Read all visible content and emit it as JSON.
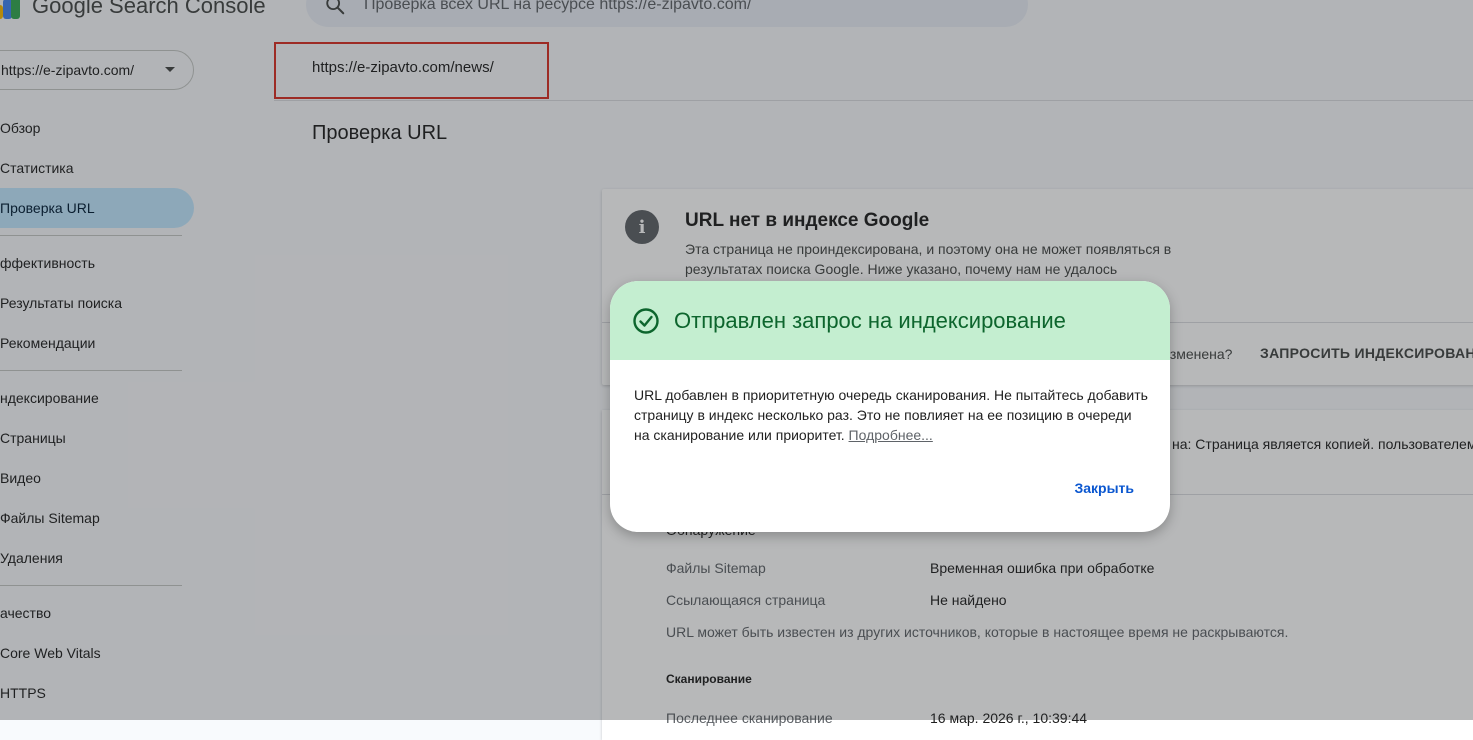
{
  "header": {
    "app_title": "Google Search Console",
    "search_placeholder": "Проверка всех URL на ресурсе https://e-zipavto.com/"
  },
  "property": {
    "label": "https://e-zipavto.com/"
  },
  "sidebar": {
    "items": [
      {
        "label": "Обзор",
        "active": false
      },
      {
        "label": "Статистика",
        "active": false
      },
      {
        "label": "Проверка URL",
        "active": true
      }
    ],
    "sections": [
      {
        "title": "ффективность",
        "items": [
          "Результаты поиска",
          "Рекомендации"
        ]
      },
      {
        "title": "ндексирование",
        "items": [
          "Страницы",
          "Видео",
          "Файлы Sitemap",
          "Удаления"
        ]
      },
      {
        "title": "ачество",
        "items": [
          "Core Web Vitals",
          "HTTPS"
        ]
      }
    ]
  },
  "main": {
    "inspected_url": "https://e-zipavto.com/news/",
    "page_title": "Проверка URL",
    "status_card": {
      "title": "URL нет в индексе Google",
      "description": "Эта страница не проиндексирована, и поэтому она не может появляться в результатах поиска Google. Ниже указано, почему нам не удалось",
      "question": "изменена?",
      "request_button": "ЗАПРОСИТЬ ИНДЕКСИРОВАНИЕ"
    },
    "details_card": {
      "status_text": "на: Страница является копией. пользователем.",
      "cut_heading": "Обнаружение",
      "rows": [
        {
          "label": "Файлы Sitemap",
          "value": "Временная ошибка при обработке"
        },
        {
          "label": "Ссылающаяся страница",
          "value": "Не найдено"
        }
      ],
      "note": "URL может быть известен из других источников, которые в настоящее время не раскрываются.",
      "section_title": "Сканирование",
      "last_crawl_label": "Последнее сканирование",
      "last_crawl_value": "16 мар. 2026 г., 10:39:44"
    }
  },
  "dialog": {
    "title": "Отправлен запрос на индексирование",
    "body": "URL добавлен в приоритетную очередь сканирования. Не пытайтесь добавить страницу в индекс несколько раз. Это не повлияет на ее позицию в очереди на сканирование или приоритет.",
    "link": "Подробнее...",
    "close_button": "Закрыть"
  },
  "colors": {
    "accent": "#0b57d0",
    "success": "#0d652d",
    "success_bg": "#c4eed0",
    "highlight_border": "#d93025",
    "nav_active": "#c2e7ff"
  }
}
